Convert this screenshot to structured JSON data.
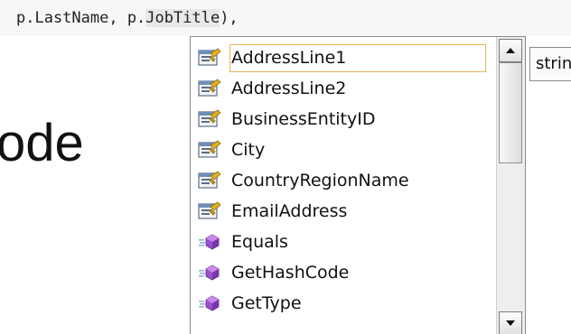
{
  "editor": {
    "code_before": "p.LastName, p.",
    "code_highlight": "JobTitle",
    "code_after": "),",
    "background_text": "ode"
  },
  "intellisense": {
    "items": [
      {
        "label": "AddressLine1",
        "icon": "property-icon",
        "selected": true
      },
      {
        "label": "AddressLine2",
        "icon": "property-icon",
        "selected": false
      },
      {
        "label": "BusinessEntityID",
        "icon": "property-icon",
        "selected": false
      },
      {
        "label": "City",
        "icon": "property-icon",
        "selected": false
      },
      {
        "label": "CountryRegionName",
        "icon": "property-icon",
        "selected": false
      },
      {
        "label": "EmailAddress",
        "icon": "property-icon",
        "selected": false
      },
      {
        "label": "Equals",
        "icon": "method-icon",
        "selected": false
      },
      {
        "label": "GetHashCode",
        "icon": "method-icon",
        "selected": false
      },
      {
        "label": "GetType",
        "icon": "method-icon",
        "selected": false
      }
    ],
    "tooltip": "strin",
    "colors": {
      "selection_border": "#e8b25a",
      "method_purple": "#9b4fd0",
      "property_gold": "#e0b020"
    }
  }
}
